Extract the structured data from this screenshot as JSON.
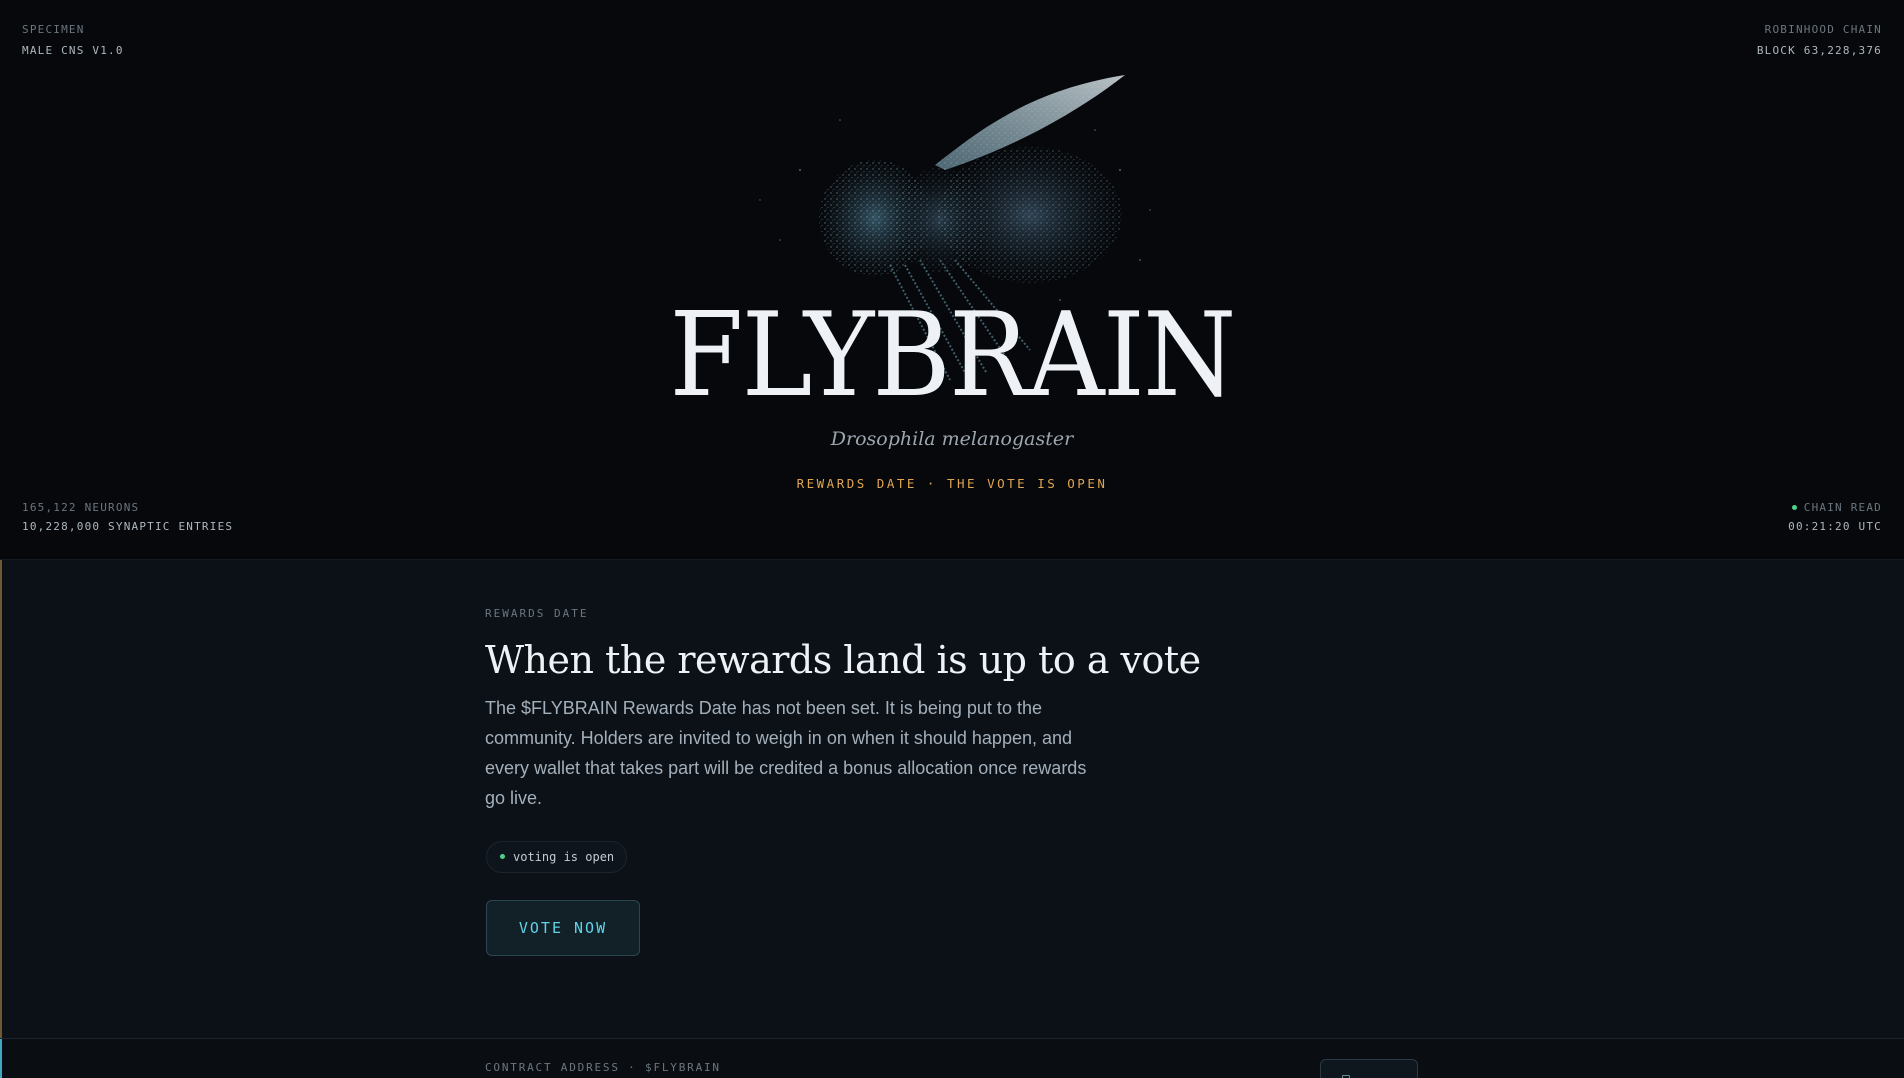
{
  "hero": {
    "top_left": {
      "label": "SPECIMEN",
      "value": "MALE CNS V1.0"
    },
    "top_right": {
      "label": "ROBINHOOD CHAIN",
      "value": "BLOCK 63,228,376"
    },
    "bottom_left": {
      "label": "165,122 NEURONS",
      "value": "10,228,000 SYNAPTIC ENTRIES"
    },
    "bottom_right": {
      "label": "CHAIN READ",
      "value": "00:21:20 UTC"
    },
    "title": "FLYBRAIN",
    "subtitle": "Drosophila melanogaster",
    "banner": "REWARDS DATE · THE VOTE IS OPEN"
  },
  "rewards": {
    "eyebrow": "REWARDS DATE",
    "heading": "When the rewards land is up to a vote",
    "body": "The $FLYBRAIN Rewards Date has not been set. It is being put to the community. Holders are invited to weigh in on when it should happen, and every wallet that takes part will be credited a bonus allocation once rewards go live.",
    "status": "voting is open",
    "vote_label": "VOTE NOW"
  },
  "contract": {
    "label": "CONTRACT ADDRESS · $FLYBRAIN"
  },
  "colors": {
    "accent_gold": "#e0a552",
    "accent_cyan": "#5fd4e8",
    "status_green": "#4fd08a"
  }
}
